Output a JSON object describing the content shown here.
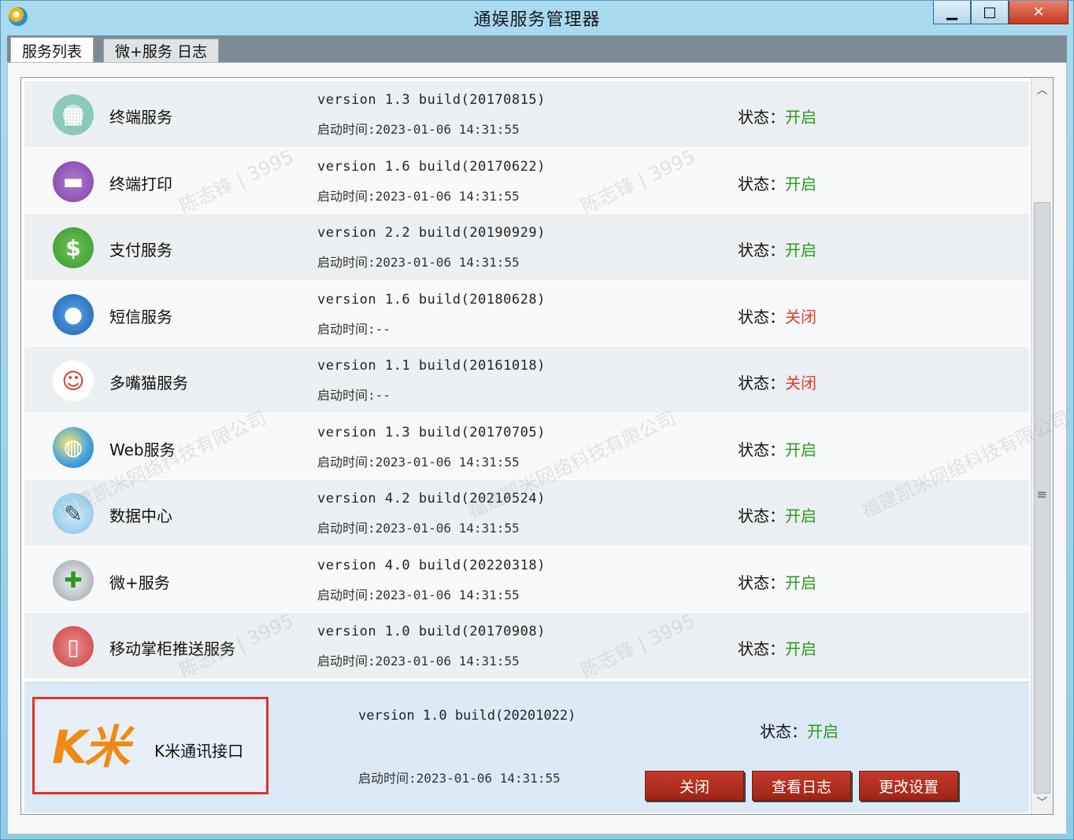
{
  "window": {
    "title": "通娱服务管理器",
    "buttons": {
      "minimize": "▁",
      "maximize": "□",
      "close": "✕"
    }
  },
  "tabs": [
    {
      "label": "服务列表",
      "active": true
    },
    {
      "label": "微+服务 日志",
      "active": false
    }
  ],
  "status_label": "状态：",
  "services": [
    {
      "icon": "terminal-service-icon",
      "name": "终端服务",
      "version": "version 1.3 build(20170815)",
      "start_time": "启动时间:2023-01-06 14:31:55",
      "status": "开启"
    },
    {
      "icon": "printer-icon",
      "name": "终端打印",
      "version": "version 1.6 build(20170622)",
      "start_time": "启动时间:2023-01-06 14:31:55",
      "status": "开启"
    },
    {
      "icon": "dollar-icon",
      "name": "支付服务",
      "version": "version 2.2 build(20190929)",
      "start_time": "启动时间:2023-01-06 14:31:55",
      "status": "开启"
    },
    {
      "icon": "chat-bubble-icon",
      "name": "短信服务",
      "version": "version 1.6 build(20180628)",
      "start_time": "启动时间:--",
      "status": "关闭"
    },
    {
      "icon": "multi-face-icon",
      "name": "多嘴猫服务",
      "version": "version 1.1 build(20161018)",
      "start_time": "启动时间:--",
      "status": "关闭"
    },
    {
      "icon": "globe-icon",
      "name": "Web服务",
      "version": "version 1.3 build(20170705)",
      "start_time": "启动时间:2023-01-06 14:31:55",
      "status": "开启"
    },
    {
      "icon": "data-center-icon",
      "name": "数据中心",
      "version": "version 4.2 build(20210524)",
      "start_time": "启动时间:2023-01-06 14:31:55",
      "status": "开启"
    },
    {
      "icon": "database-add-icon",
      "name": "微+服务",
      "version": "version 4.0 build(20220318)",
      "start_time": "启动时间:2023-01-06 14:31:55",
      "status": "开启"
    },
    {
      "icon": "mobile-icon",
      "name": "移动掌柜推送服务",
      "version": "version 1.0 build(20170908)",
      "start_time": "启动时间:2023-01-06 14:31:55",
      "status": "开启"
    }
  ],
  "selected_service": {
    "logo_text": "K米",
    "name": "K米通讯接口",
    "version": "version 1.0 build(20201022)",
    "start_time": "启动时间:2023-01-06 14:31:55",
    "status": "开启",
    "actions": {
      "close": "关闭",
      "view_log": "查看日志",
      "settings": "更改设置"
    }
  },
  "colors": {
    "status_on": "#2a9a1a",
    "status_off": "#e03a2a",
    "highlight": "#e0332a",
    "action_button": "#b02e1e"
  },
  "watermarks": [
    "福建凯米网络科技有限公司",
    "陈志锋 | 3995"
  ]
}
